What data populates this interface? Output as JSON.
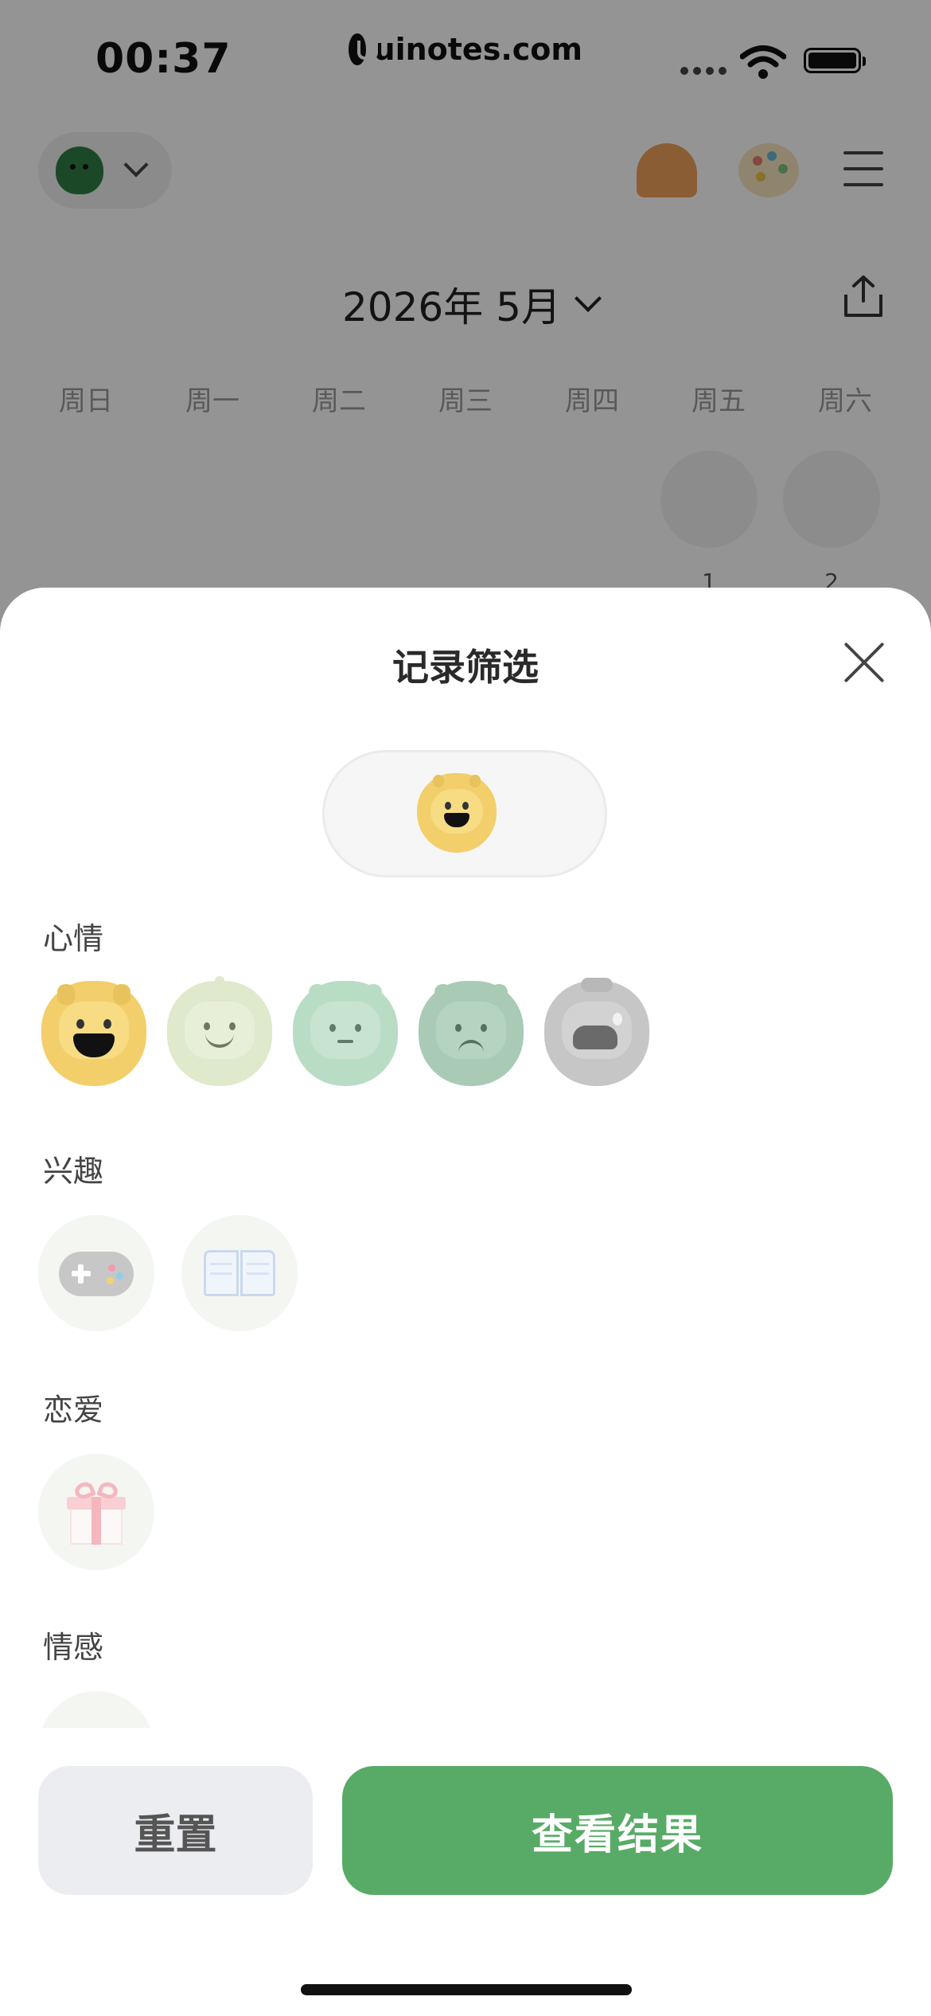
{
  "status_bar": {
    "time": "00:37"
  },
  "watermark": {
    "text": "uinotes.com"
  },
  "calendar": {
    "month_title": "2026年 5月",
    "weekdays": [
      "周日",
      "周一",
      "周二",
      "周三",
      "周四",
      "周五",
      "周六"
    ],
    "visible_days": [
      "1",
      "2"
    ]
  },
  "sheet": {
    "title": "记录筛选",
    "sections": {
      "mood": "心情",
      "interest": "兴趣",
      "love": "恋爱",
      "emotion": "情感"
    },
    "mood_options": [
      "great-mood-icon",
      "good-mood-icon",
      "neutral-mood-icon",
      "bad-mood-icon",
      "awful-mood-icon"
    ],
    "interest_options": [
      "gamepad-icon",
      "book-icon"
    ],
    "love_options": [
      "gift-icon"
    ]
  },
  "buttons": {
    "reset": "重置",
    "view_results": "查看结果"
  },
  "colors": {
    "accent_green": "#58ab66",
    "mood_great": "#f2cf6b",
    "mood_good": "#dbe7c5",
    "mood_neutral": "#b7dcc3",
    "mood_bad": "#a9cdb7",
    "mood_awful": "#c6c6c6"
  }
}
